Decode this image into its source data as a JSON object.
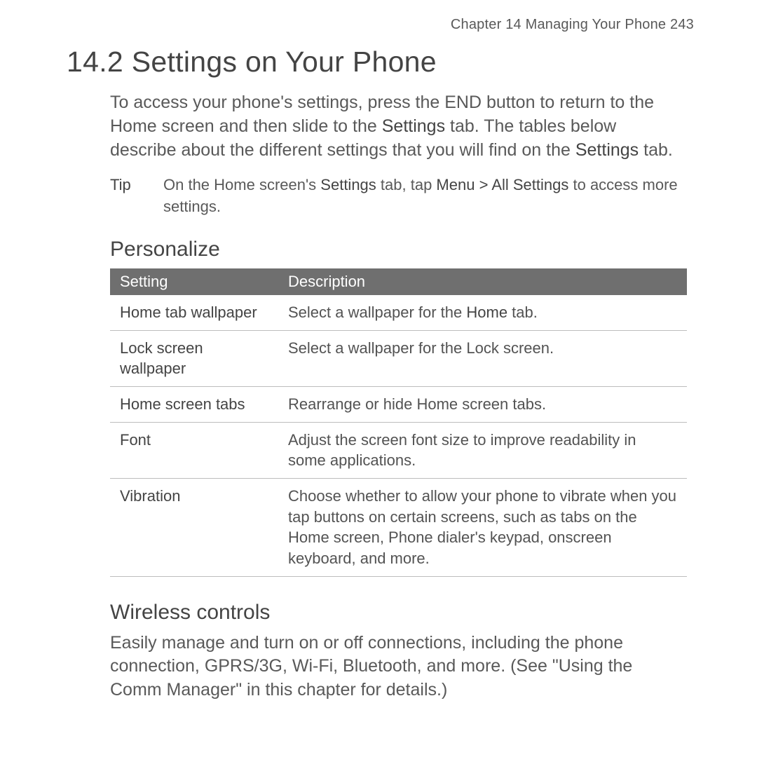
{
  "header": {
    "chapter": "Chapter 14  Managing Your Phone",
    "page_number": "243"
  },
  "section": {
    "number": "14.2",
    "title": "Settings on Your Phone"
  },
  "intro": {
    "p1a": "To access your phone's settings, press the END button to return to the Home screen and then slide to the ",
    "p1b": "Settings",
    "p1c": " tab. The tables below describe about the different settings that you will find on the ",
    "p1d": "Settings",
    "p1e": " tab."
  },
  "tip": {
    "label": "Tip",
    "t1": "On the Home screen's ",
    "t2": "Settings",
    "t3": " tab, tap ",
    "t4": "Menu > All Settings",
    "t5": " to access more settings."
  },
  "personalize": {
    "title": "Personalize",
    "headers": {
      "col1": "Setting",
      "col2": "Description"
    },
    "rows": [
      {
        "setting": "Home tab wallpaper",
        "desc_a": "Select a wallpaper for the ",
        "desc_b": "Home",
        "desc_c": " tab."
      },
      {
        "setting": "Lock screen wallpaper",
        "desc_a": "Select a wallpaper for the Lock screen.",
        "desc_b": "",
        "desc_c": ""
      },
      {
        "setting": "Home screen tabs",
        "desc_a": "Rearrange or hide Home screen tabs.",
        "desc_b": "",
        "desc_c": ""
      },
      {
        "setting": "Font",
        "desc_a": "Adjust the screen font size to improve readability in some applications.",
        "desc_b": "",
        "desc_c": ""
      },
      {
        "setting": "Vibration",
        "desc_a": "Choose whether to allow your phone to vibrate when you tap buttons on certain screens, such as tabs on the Home screen, Phone dialer's keypad, onscreen keyboard, and more.",
        "desc_b": "",
        "desc_c": ""
      }
    ]
  },
  "wireless": {
    "title": "Wireless controls",
    "body": "Easily manage and turn on or off connections, including the phone connection, GPRS/3G, Wi-Fi, Bluetooth, and more. (See \"Using the Comm Manager\" in this chapter for details.)"
  }
}
